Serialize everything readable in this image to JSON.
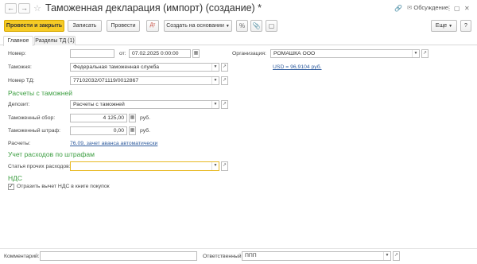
{
  "window": {
    "title": "Таможенная декларация (импорт) (создание) *",
    "discussion_label": "Обсуждение"
  },
  "toolbar": {
    "post_and_close": "Провести и закрыть",
    "save": "Записать",
    "post": "Провести",
    "create_based_on": "Создать на основании",
    "more": "Еще",
    "help": "?"
  },
  "tabs": [
    {
      "label": "Главное",
      "active": true
    },
    {
      "label": "Разделы ТД (1)",
      "active": false
    }
  ],
  "form": {
    "number_label": "Номер:",
    "number_value": "",
    "date_from_label": "от:",
    "date_value": "07.02.2025  0:00:00",
    "organization_label": "Организация:",
    "organization_value": "РОМАШКА ООО",
    "customs_label": "Таможня:",
    "customs_value": "Федеральная таможенная служба",
    "currency_rate_link": "USD = 96,9104 руб.",
    "td_number_label": "Номер ТД:",
    "td_number_value": "77102032/071119/0012867"
  },
  "customs_settlements": {
    "heading": "Расчеты с таможней",
    "deposit_label": "Депозит:",
    "deposit_value": "Расчеты с таможней",
    "fee_label": "Таможенный сбор:",
    "fee_value": "4 125,00",
    "fee_unit": "руб.",
    "fine_label": "Таможенный штраф:",
    "fine_value": "0,00",
    "fine_unit": "руб.",
    "settlements_label": "Расчеты:",
    "settlements_link": "76.09, зачет аванса автоматически"
  },
  "fines": {
    "heading": "Учет расходов по штрафам",
    "other_expenses_label": "Статья прочих расходов:",
    "other_expenses_value": ""
  },
  "vat": {
    "heading": "НДС",
    "reflect_deduction_label": "Отразить вычет НДС в книге покупок",
    "reflect_deduction_checked": true
  },
  "footer": {
    "comment_label": "Комментарий:",
    "comment_value": "",
    "responsible_label": "Ответственный:",
    "responsible_value": "ППП"
  },
  "colors": {
    "primary_button": "#f6cb26",
    "section_heading": "#3a9d3f",
    "link": "#2f5c9e",
    "focused_field_border": "#e8b923"
  }
}
